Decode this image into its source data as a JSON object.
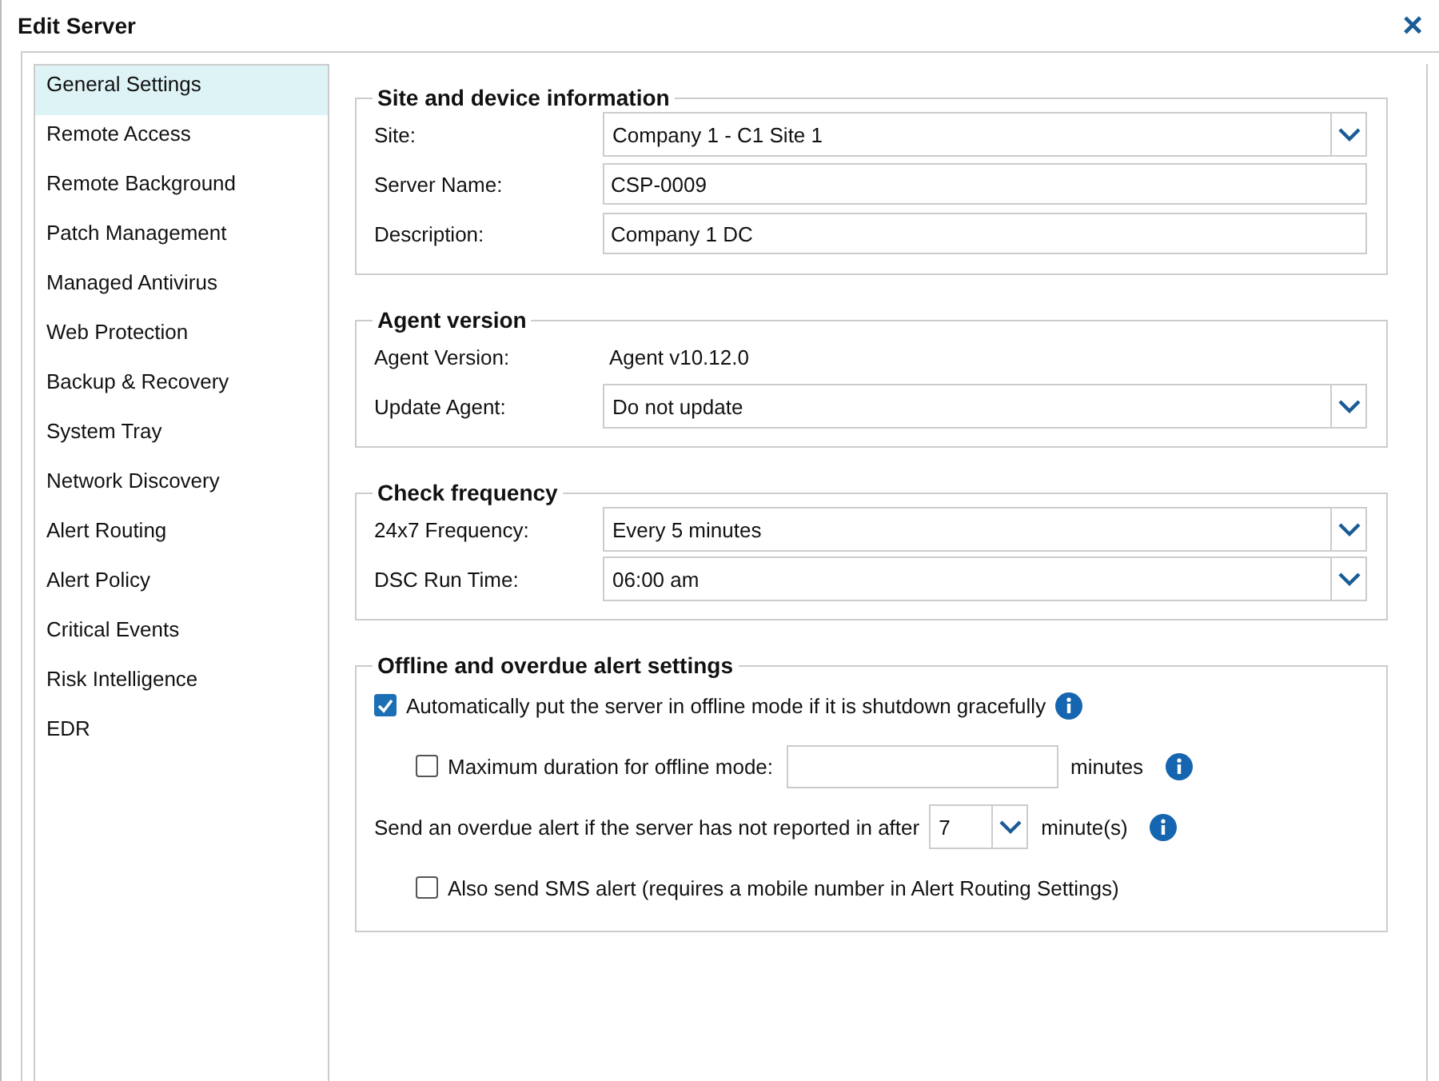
{
  "window": {
    "title": "Edit Server",
    "close": "×"
  },
  "sidebar": {
    "items": [
      {
        "label": "General Settings",
        "selected": true
      },
      {
        "label": "Remote Access",
        "selected": false
      },
      {
        "label": "Remote Background",
        "selected": false
      },
      {
        "label": "Patch Management",
        "selected": false
      },
      {
        "label": "Managed Antivirus",
        "selected": false
      },
      {
        "label": "Web Protection",
        "selected": false
      },
      {
        "label": "Backup & Recovery",
        "selected": false
      },
      {
        "label": "System Tray",
        "selected": false
      },
      {
        "label": "Network Discovery",
        "selected": false
      },
      {
        "label": "Alert Routing",
        "selected": false
      },
      {
        "label": "Alert Policy",
        "selected": false
      },
      {
        "label": "Critical Events",
        "selected": false
      },
      {
        "label": "Risk Intelligence",
        "selected": false
      },
      {
        "label": "EDR",
        "selected": false
      }
    ]
  },
  "sections": [
    {
      "title": "Site and device information",
      "rows": [
        {
          "kind": "select",
          "label": "Site:",
          "value": "Company 1 - C1 Site 1"
        },
        {
          "kind": "text",
          "label": "Server Name:",
          "value": "CSP-0009"
        },
        {
          "kind": "text",
          "label": "Description:",
          "value": "Company 1 DC"
        }
      ]
    },
    {
      "title": "Agent version",
      "rows": [
        {
          "kind": "static",
          "label": "Agent Version:",
          "value": "Agent v10.12.0"
        },
        {
          "kind": "select",
          "label": "Update Agent:",
          "value": "Do not update"
        }
      ]
    },
    {
      "title": "Check frequency",
      "rows": [
        {
          "kind": "select",
          "label": "24x7 Frequency:",
          "value": "Every 5 minutes"
        },
        {
          "kind": "select",
          "label": "DSC Run Time:",
          "value": "06:00 am"
        }
      ]
    }
  ],
  "alerts": {
    "title": "Offline and overdue alert settings",
    "auto_offline": {
      "label": "Automatically put the server in offline mode if it is shutdown gracefully",
      "checked": true
    },
    "max_duration": {
      "label": "Maximum duration for offline mode:",
      "checked": false,
      "unit": "minutes"
    },
    "overdue": {
      "label": "Send an overdue alert if the server has not reported in after",
      "value": "7",
      "unit": "minute(s)"
    },
    "sms": {
      "label": "Also send SMS alert (requires a mobile number in Alert Routing Settings)",
      "checked": false
    }
  }
}
